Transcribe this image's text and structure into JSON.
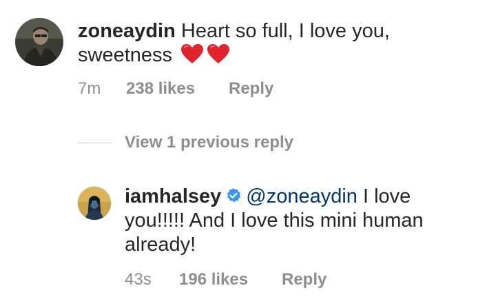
{
  "comment1": {
    "username": "zoneaydin",
    "text": "Heart so full, I love you, sweetness",
    "emoji": [
      "red-heart",
      "red-heart"
    ],
    "time": "7m",
    "likes": "238 likes",
    "reply_label": "Reply"
  },
  "view_replies": {
    "label": "View 1 previous reply"
  },
  "comment2": {
    "username": "iamhalsey",
    "verified": true,
    "mention": "@zoneaydin",
    "text": " I love you!!!!! And I love this mini human already!",
    "time": "43s",
    "likes": "196 likes",
    "reply_label": "Reply"
  },
  "colors": {
    "text": "#262626",
    "secondary": "#8e8e8e",
    "mention": "#00376b",
    "verified": "#3897f0",
    "heart": "#e0242e"
  }
}
